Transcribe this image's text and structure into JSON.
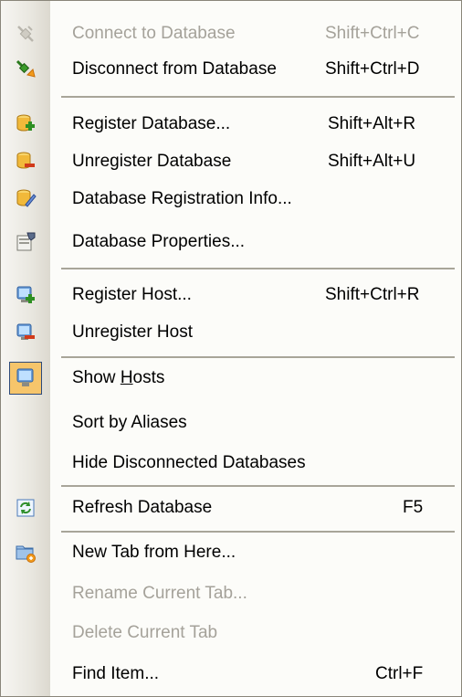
{
  "menu": {
    "items": [
      {
        "label": "Connect to Database",
        "shortcut": "Shift+Ctrl+C",
        "icon": "plug-connect-icon",
        "enabled": false
      },
      {
        "label": "Disconnect from Database",
        "shortcut": "Shift+Ctrl+D",
        "icon": "plug-disconnect-icon",
        "enabled": true
      },
      {
        "label": "Register Database...",
        "shortcut": "Shift+Alt+R",
        "icon": "database-add-icon",
        "enabled": true
      },
      {
        "label": "Unregister Database",
        "shortcut": "Shift+Alt+U",
        "icon": "database-remove-icon",
        "enabled": true
      },
      {
        "label": "Database Registration Info...",
        "shortcut": "",
        "icon": "database-edit-icon",
        "enabled": true
      },
      {
        "label": "Database Properties...",
        "shortcut": "",
        "icon": "database-properties-icon",
        "enabled": true
      },
      {
        "label": "Register Host...",
        "shortcut": "Shift+Ctrl+R",
        "icon": "host-add-icon",
        "enabled": true
      },
      {
        "label": "Unregister Host",
        "shortcut": "",
        "icon": "host-remove-icon",
        "enabled": true
      },
      {
        "label_before": "Show ",
        "label_underline": "H",
        "label_after": "osts",
        "shortcut": "",
        "icon": "host-show-icon",
        "enabled": true,
        "checked": true
      },
      {
        "label": "Sort by Aliases",
        "shortcut": "",
        "icon": "",
        "enabled": true
      },
      {
        "label": "Hide Disconnected Databases",
        "shortcut": "",
        "icon": "",
        "enabled": true
      },
      {
        "label": "Refresh Database",
        "shortcut": "F5",
        "icon": "refresh-icon",
        "enabled": true
      },
      {
        "label": "New Tab from Here...",
        "shortcut": "",
        "icon": "folder-tab-new-icon",
        "enabled": true
      },
      {
        "label": "Rename Current Tab...",
        "shortcut": "",
        "icon": "",
        "enabled": false
      },
      {
        "label": "Delete Current Tab",
        "shortcut": "",
        "icon": "",
        "enabled": false
      },
      {
        "label": "Find Item...",
        "shortcut": "Ctrl+F",
        "icon": "",
        "enabled": true
      }
    ]
  },
  "colors": {
    "menu_background": "#fcfcf9",
    "disabled_text": "#a5a29a",
    "separator": "#a8a599",
    "checked_highlight": "#f6c56b"
  }
}
